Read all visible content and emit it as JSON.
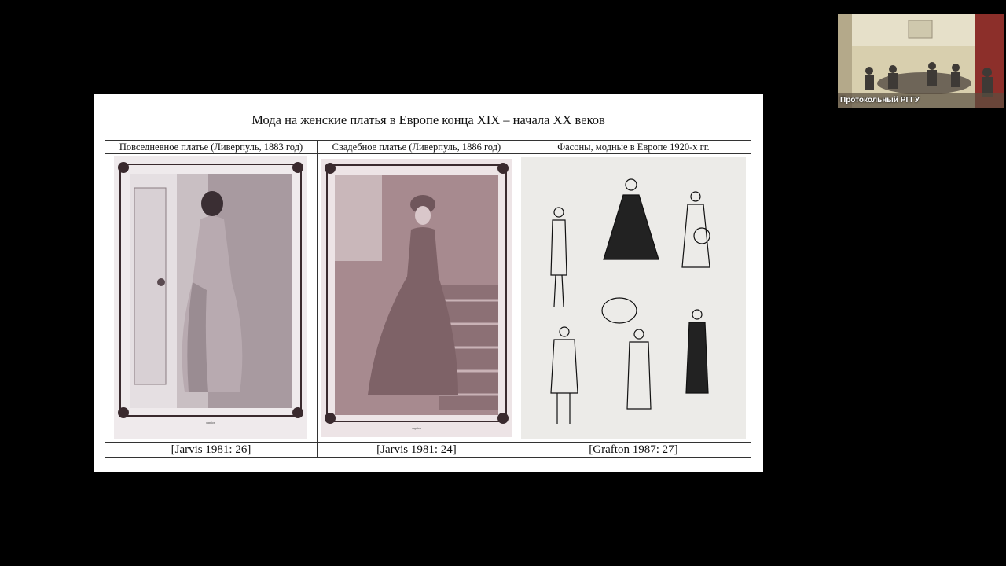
{
  "slide": {
    "title": "Мода на женские платья в Европе конца XIX – начала XX веков",
    "columns": [
      {
        "header": "Повседневное платье (Ливерпуль, 1883 год)",
        "source": "[Jarvis 1981: 26]",
        "image": "photo-woman-day-dress"
      },
      {
        "header": "Свадебное платье (Ливерпуль, 1886 год)",
        "source": "[Jarvis 1981: 24]",
        "image": "photo-woman-wedding-dress"
      },
      {
        "header": "Фасоны, модные в Европе 1920-х гг.",
        "source": "[Grafton 1987: 27]",
        "image": "fashion-sketches-1920s"
      }
    ]
  },
  "participant": {
    "name": "Протокольный РГГУ"
  },
  "colors": {
    "background": "#000000",
    "slide": "#ffffff",
    "photo_tone": "#b89a9e",
    "name_text": "#ffffff"
  }
}
